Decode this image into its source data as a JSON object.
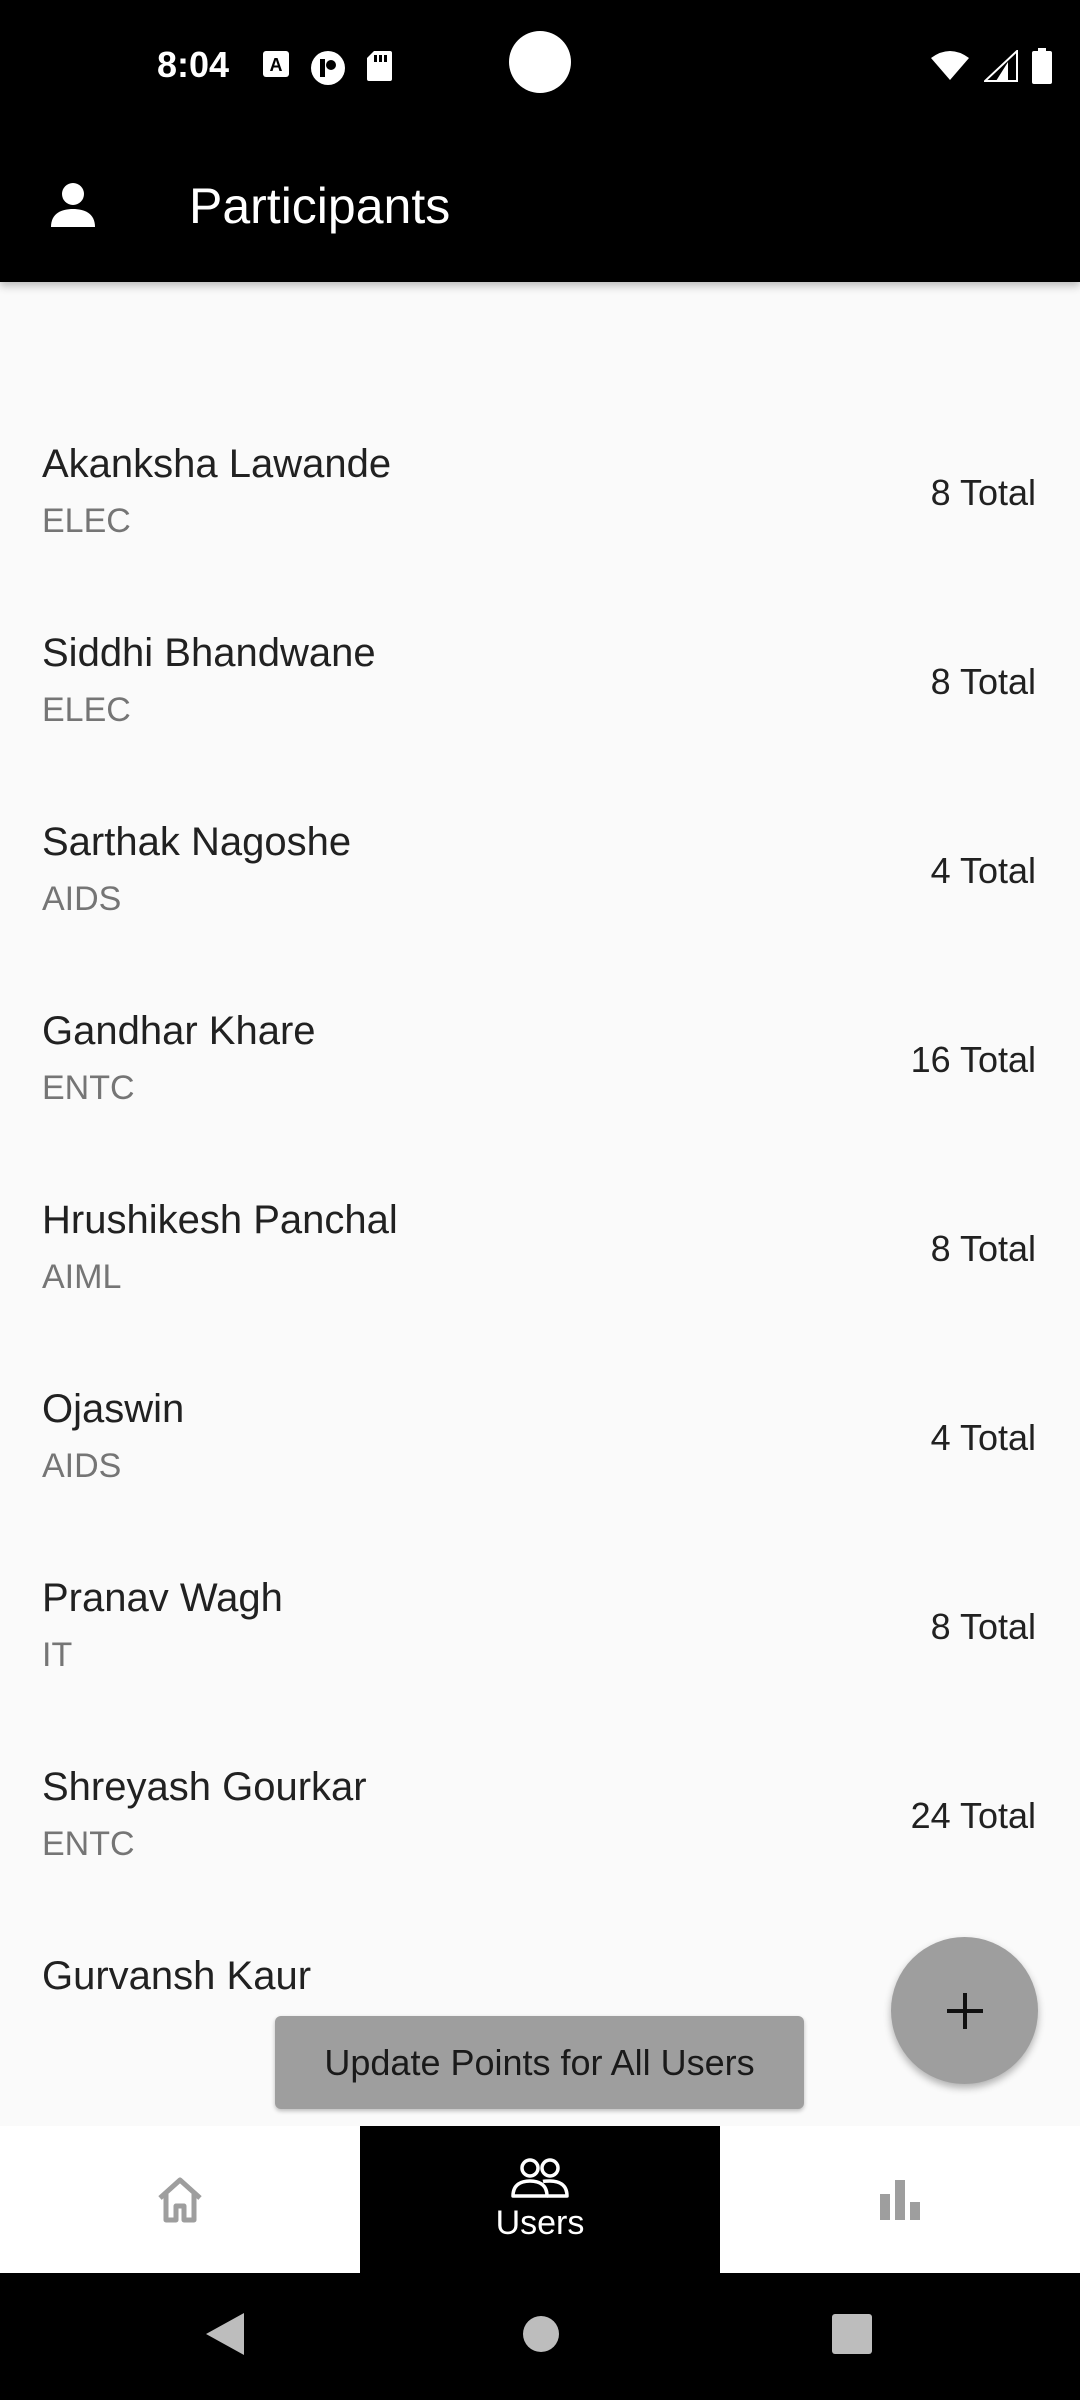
{
  "status_bar": {
    "time": "8:04",
    "left_icons": [
      "a-icon",
      "circle-p-icon",
      "sd-card-icon"
    ],
    "right_icons": [
      "wifi-icon",
      "cell-signal-icon",
      "battery-icon"
    ]
  },
  "app_bar": {
    "icon": "person-icon",
    "title": "Participants"
  },
  "participants": [
    {
      "name": "Akanksha Lawande",
      "dept": "ELEC",
      "total": "8 Total"
    },
    {
      "name": "Siddhi Bhandwane",
      "dept": "ELEC",
      "total": "8 Total"
    },
    {
      "name": "Sarthak Nagoshe",
      "dept": "AIDS",
      "total": "4 Total"
    },
    {
      "name": "Gandhar Khare",
      "dept": "ENTC",
      "total": "16 Total"
    },
    {
      "name": "Hrushikesh Panchal",
      "dept": "AIML",
      "total": "8 Total"
    },
    {
      "name": "Ojaswin",
      "dept": "AIDS",
      "total": "4 Total"
    },
    {
      "name": "Pranav Wagh",
      "dept": "IT",
      "total": "8 Total"
    },
    {
      "name": "Shreyash Gourkar",
      "dept": "ENTC",
      "total": "24 Total"
    },
    {
      "name": "Gurvansh Kaur",
      "dept": "",
      "total": ""
    }
  ],
  "update_button": {
    "label": "Update Points for All Users"
  },
  "fab": {
    "icon": "plus-icon"
  },
  "bottom_nav": {
    "items": [
      {
        "icon": "home-icon",
        "label": ""
      },
      {
        "icon": "users-icon",
        "label": "Users"
      },
      {
        "icon": "bar-chart-icon",
        "label": ""
      }
    ],
    "active_index": 1
  },
  "system_nav": {
    "icons": [
      "back-icon",
      "home-circle-icon",
      "recents-icon"
    ]
  },
  "colors": {
    "app_bar": "#000000",
    "background": "#fafafa",
    "fab": "#9e9e9e",
    "button": "#9e9e9e",
    "secondary_text": "#757575"
  }
}
